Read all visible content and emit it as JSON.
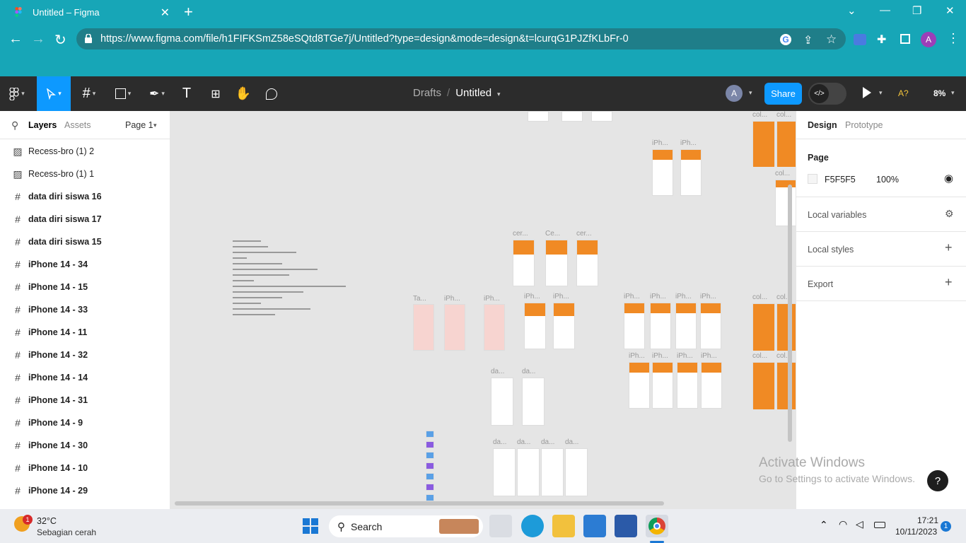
{
  "browser": {
    "tab_title": "Untitled – Figma",
    "url": "https://www.figma.com/file/h1FIFKSmZ58eSQtd8TGe7j/Untitled?type=design&mode=design&t=lcurqG1PJZfKLbFr-0",
    "profile_initial": "A"
  },
  "toolbar": {
    "breadcrumb_parent": "Drafts",
    "file_name": "Untitled",
    "avatar_initial": "A",
    "share_label": "Share",
    "a11y_label": "A?",
    "zoom": "8%"
  },
  "left_panel": {
    "tab_layers": "Layers",
    "tab_assets": "Assets",
    "page_label": "Page 1",
    "layers": [
      {
        "name": "Recess-bro (1) 2",
        "kind": "image"
      },
      {
        "name": "Recess-bro (1) 1",
        "kind": "image"
      },
      {
        "name": "data diri siswa 16",
        "kind": "frame"
      },
      {
        "name": "data diri siswa 17",
        "kind": "frame"
      },
      {
        "name": "data diri siswa 15",
        "kind": "frame"
      },
      {
        "name": "iPhone 14 - 34",
        "kind": "frame"
      },
      {
        "name": "iPhone 14 - 15",
        "kind": "frame"
      },
      {
        "name": "iPhone 14 - 33",
        "kind": "frame"
      },
      {
        "name": "iPhone 14 - 11",
        "kind": "frame"
      },
      {
        "name": "iPhone 14 - 32",
        "kind": "frame"
      },
      {
        "name": "iPhone 14 - 14",
        "kind": "frame"
      },
      {
        "name": "iPhone 14 - 31",
        "kind": "frame"
      },
      {
        "name": "iPhone 14 - 9",
        "kind": "frame"
      },
      {
        "name": "iPhone 14 - 30",
        "kind": "frame"
      },
      {
        "name": "iPhone 14 - 10",
        "kind": "frame"
      },
      {
        "name": "iPhone 14 - 29",
        "kind": "frame"
      }
    ]
  },
  "canvas": {
    "labels": {
      "iph": "iPh...",
      "col": "col...",
      "cer": "cer...",
      "ce": "Ce...",
      "ta": "Ta...",
      "da": "da..."
    },
    "watermark_title": "Activate Windows",
    "watermark_sub": "Go to Settings to activate Windows.",
    "help": "?"
  },
  "right_panel": {
    "tab_design": "Design",
    "tab_prototype": "Prototype",
    "page_heading": "Page",
    "page_color": "F5F5F5",
    "page_opacity": "100%",
    "local_variables": "Local variables",
    "local_styles": "Local styles",
    "export": "Export"
  },
  "taskbar": {
    "weather_temp": "32°C",
    "weather_desc": "Sebagian cerah",
    "weather_badge": "1",
    "search_label": "Search",
    "time": "17:21",
    "date": "10/11/2023",
    "notif_count": "1"
  },
  "colors": {
    "chrome": "#17a6b7",
    "figma_dark": "#2c2c2c",
    "figma_blue": "#0d99ff",
    "frame_orange": "#f08a24"
  }
}
